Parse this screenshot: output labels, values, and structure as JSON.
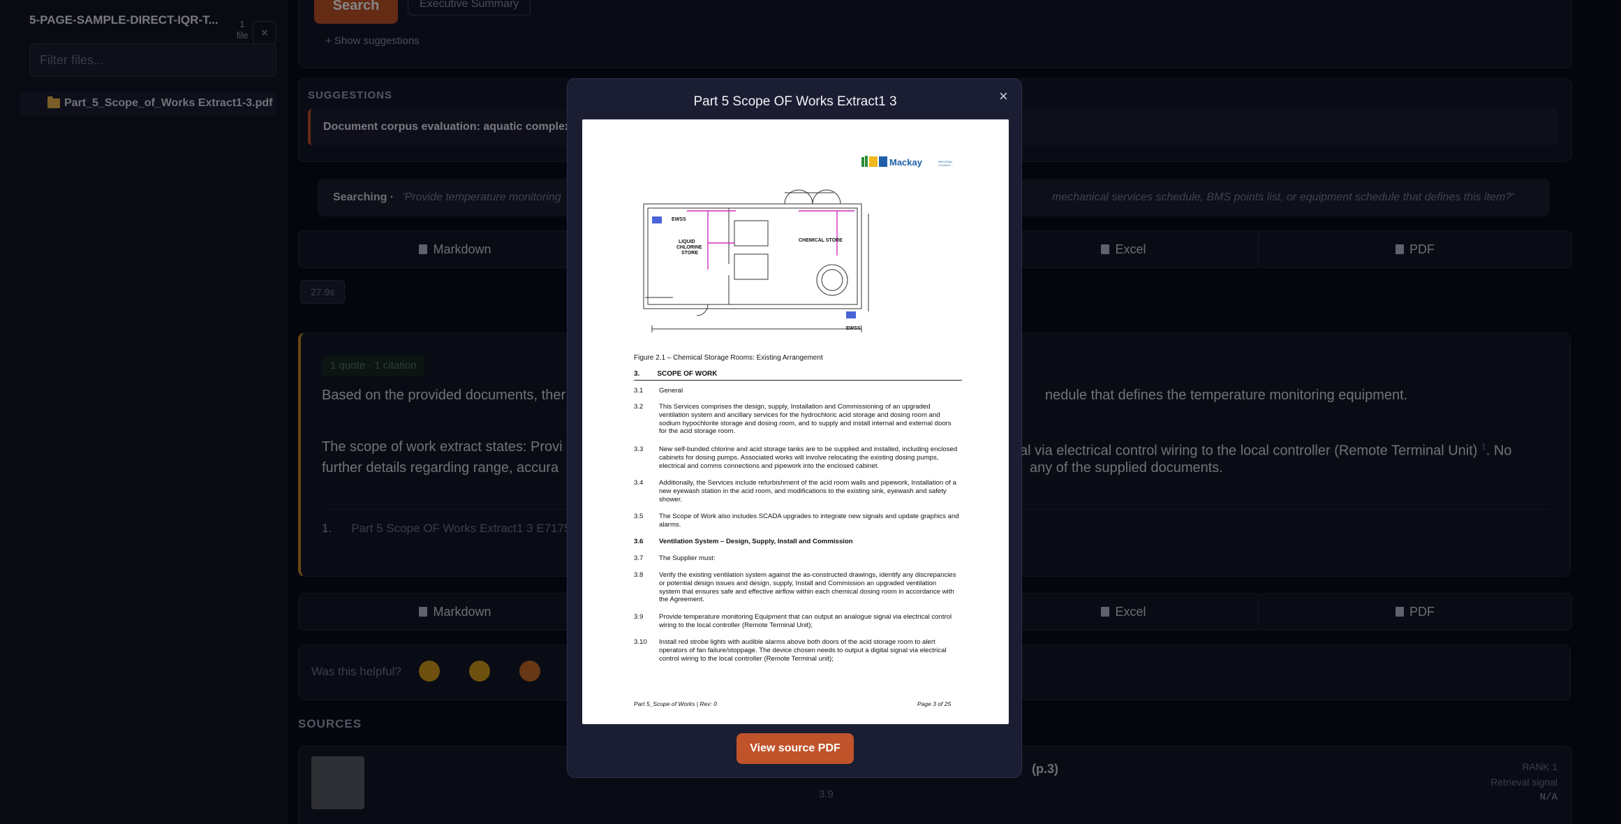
{
  "sidebar": {
    "title": "5-PAGE-SAMPLE-DIRECT-IQR-T...",
    "count_num": "1",
    "count_unit": "file",
    "close_label": "×",
    "filter_placeholder": "Filter files...",
    "files": [
      "Part_5_Scope_of_Works Extract1-3.pdf"
    ]
  },
  "search": {
    "button_label": "Search",
    "chip_label": "Executive Summary",
    "show_suggestions": "+ Show suggestions"
  },
  "suggestions": {
    "heading": "SUGGESTIONS",
    "item": "Document corpus evaluation: aquatic complex"
  },
  "searching": {
    "label": "Searching ·",
    "query_left": "'Provide temperature monitoring",
    "query_right": "mechanical services schedule, BMS points list, or equipment schedule that defines this item?'"
  },
  "export": {
    "markdown": "Markdown",
    "excel": "Excel",
    "pdf": "PDF"
  },
  "timing": "27.9s",
  "answer": {
    "chip": "1 quote · 1 citation",
    "p1_left": "Based on the provided documents, ther",
    "p1_right": "nedule that defines the temperature monitoring equipment.",
    "p2_l1_left": "The scope of work extract states: Provi",
    "p2_l1_right": "al via electrical control wiring to the local controller (Remote Terminal Unit)",
    "p2_sup": "1",
    "p2_l1_end": ". No",
    "p2_l2_left": "further details regarding range, accura",
    "p2_l2_right": "any of the supplied documents.",
    "cite_num": "1.",
    "cite_text": "Part 5 Scope OF Works Extract1 3 E7175"
  },
  "feedback": {
    "label": "Was this helpful?"
  },
  "sources": {
    "heading": "SOURCES",
    "card_title": "(p.3)",
    "card_meta": "3.9",
    "rank": "RANK 1",
    "signal": "Retrieval signal",
    "value": "N/A"
  },
  "modal": {
    "title": "Part 5 Scope OF Works Extract1 3",
    "close": "×",
    "view_button": "View source PDF",
    "logo_text": "Mackay",
    "figure_caption": "Figure 2.1 – Chemical Storage Rooms: Existing Arrangement",
    "section_num": "3.",
    "section_title": "SCOPE OF WORK",
    "drawing_labels": {
      "ewss1": "EWSS",
      "liquid": "LIQUID",
      "chlorine": "CHLORINE",
      "store": "STORE",
      "chem": "CHEMICAL STORE",
      "ewss2": "EWSS"
    },
    "clauses": [
      {
        "n": "3.1",
        "t": "General"
      },
      {
        "n": "3.2",
        "t": "This Services comprises the design, supply, Installation and Commissioning of an upgraded ventilation system and ancillary services for the hydrochloric acid storage and dosing room and sodium hypochlorite storage and dosing room, and to supply and install internal and external doors for the acid storage room."
      },
      {
        "n": "3.3",
        "t": "New self-bunded chlorine and acid storage tanks are to be supplied and installed, including enclosed cabinets for dosing pumps. Associated works will involve relocating the existing dosing pumps, electrical and comms connections and pipework into the enclosed cabinet."
      },
      {
        "n": "3.4",
        "t": "Additionally, the Services include refurbishment of the acid room walls and pipework, Installation of a new eyewash station in the acid room, and modifications to the existing sink, eyewash and safety shower."
      },
      {
        "n": "3.5",
        "t": "The Scope of Work also includes SCADA upgrades to integrate new signals and update graphics and alarms."
      },
      {
        "n": "3.6",
        "t": "Ventilation System – Design, Supply, Install and Commission"
      },
      {
        "n": "3.7",
        "t": "The Supplier must:"
      },
      {
        "n": "3.8",
        "t": "Verify the existing ventilation system against the as-constructed drawings, identify any discrepancies or potential design issues and design, supply, Install and Commission an upgraded ventilation system that ensures safe and effective airflow within each chemical dosing room in accordance with the Agreement."
      },
      {
        "n": "3.9",
        "t": "Provide temperature monitoring Equipment that can output an analogue signal via electrical control wiring to the local controller (Remote Terminal Unit);"
      },
      {
        "n": "3.10",
        "t": "Install red strobe lights with audible alarms above both doors of the acid storage room to alert operators of fan failure/stoppage. The device chosen needs to output a digital signal via electrical control wiring to the local controller (Remote Terminal unit);"
      }
    ],
    "footer_left": "Part 5_Scope of Works  |  Rev: 0",
    "footer_right": "Page 3 of 25"
  },
  "colors": {
    "accent": "#c0532a",
    "answer_border": "#c88a2a",
    "folder": "#e8b64c"
  }
}
